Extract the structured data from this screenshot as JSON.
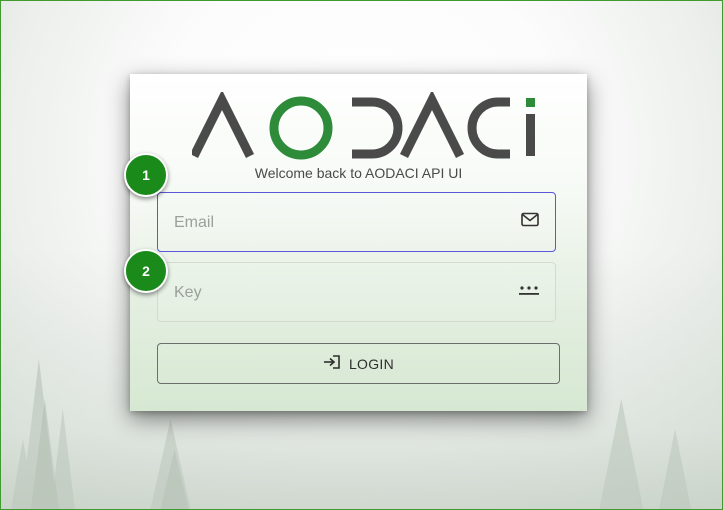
{
  "app": {
    "logo_text": "AODACI",
    "welcome_text": "Welcome back to AODACI API UI"
  },
  "form": {
    "email_placeholder": "Email",
    "email_value": "",
    "email_icon": "envelope-icon",
    "key_placeholder": "Key",
    "key_value": "",
    "key_icon": "password-dots-icon",
    "login_label": "LOGIN",
    "login_icon": "login-arrow-icon"
  },
  "annotations": {
    "badge_1": "1",
    "badge_2": "2"
  },
  "colors": {
    "accent": "#5a57d8",
    "badge_green": "#1a8a1a",
    "logo_green": "#2e8b3a",
    "logo_gray": "#4a4a4a",
    "frame_border": "#3f9b2f"
  }
}
